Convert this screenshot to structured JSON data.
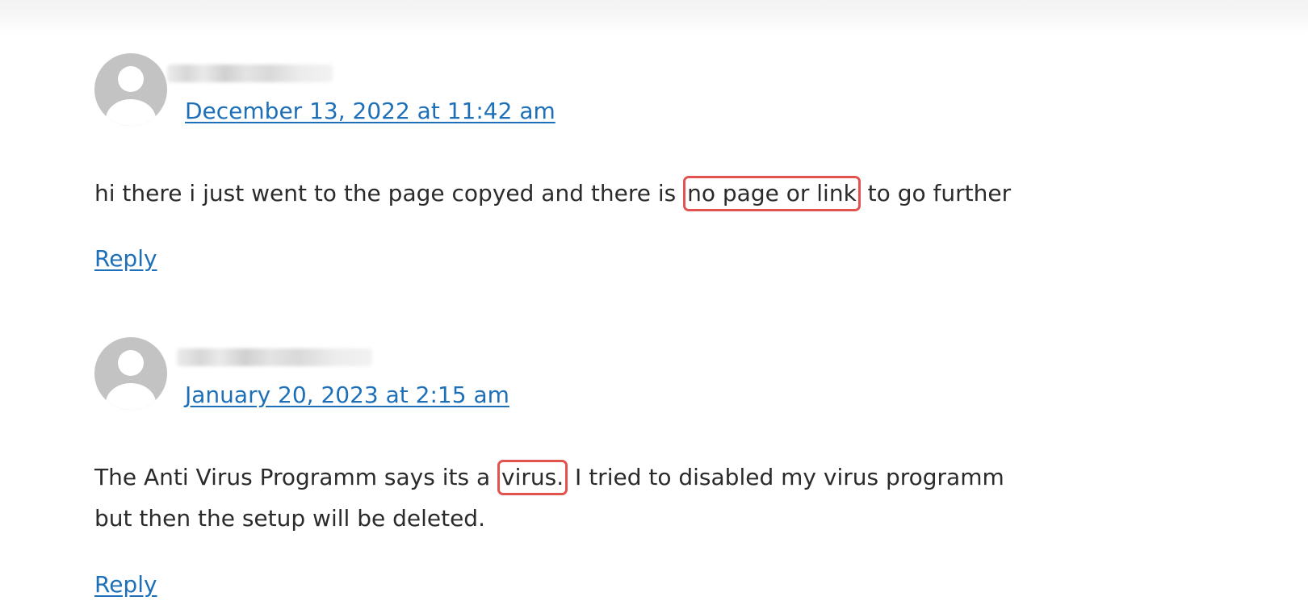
{
  "comments": [
    {
      "date": "December 13, 2022 at 11:42 am",
      "body_before": "hi there i just went to the page copyed and there is",
      "body_highlight": "no page or link",
      "body_after": "to go further",
      "reply_label": "Reply"
    },
    {
      "date": "January 20, 2023 at 2:15 am",
      "body_before": "The Anti Virus Programm says its a",
      "body_highlight": "virus.",
      "body_after": "I tried to disabled my virus programm",
      "body_line2": "but then the setup will be deleted.",
      "reply_label": "Reply"
    }
  ],
  "colors": {
    "link": "#1d6fb8",
    "text": "#2b2b2b",
    "avatar": "#c3c3c3",
    "highlight_border": "#e2534f"
  }
}
